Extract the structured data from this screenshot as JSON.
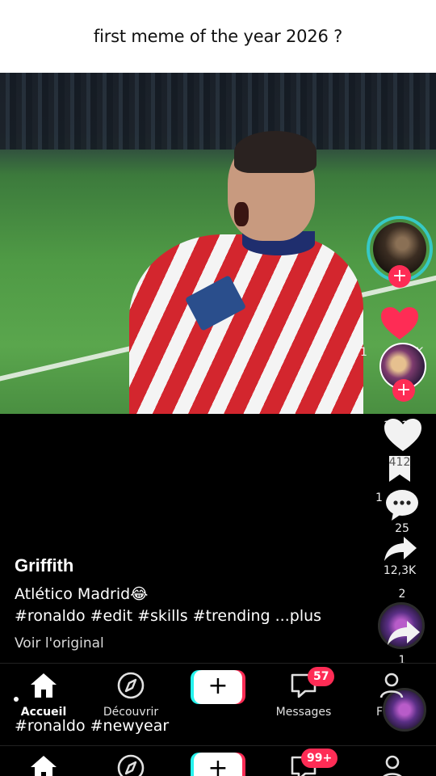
{
  "caption": "first meme of the year 2026 ?",
  "post": {
    "username": "Griffith",
    "description_line1": "Atlético Madrid😂",
    "description_line2": "#ronaldo #edit #skills #trending ...plus",
    "see_original": "Voir l'original",
    "extra_hashtags": "#ronaldo #newyear"
  },
  "actions": {
    "likes_partial": "1",
    "likes_k": "K",
    "likes_2": "12,1K",
    "bookmarks": "412",
    "comments_partial": "1",
    "comments_suffix": "...",
    "shares_a": "25",
    "shares_b": "12,3K",
    "shares_c": "2",
    "reposts": "1"
  },
  "nav": {
    "home": "Accueil",
    "discover": "Découvrir",
    "create": "+",
    "messages": "Messages",
    "messages_badge": "57",
    "profile_partial": "F",
    "messages_badge_2": "99+"
  },
  "icons": {
    "home": "home-icon",
    "discover": "compass-icon",
    "messages": "message-icon",
    "profile": "person-icon",
    "heart": "heart-icon",
    "bookmark": "bookmark-icon",
    "comment": "comment-icon",
    "share": "share-icon"
  },
  "colors": {
    "accent_red": "#fe2c55",
    "accent_cyan": "#25f4ee",
    "ring_teal": "#36c9c6"
  }
}
